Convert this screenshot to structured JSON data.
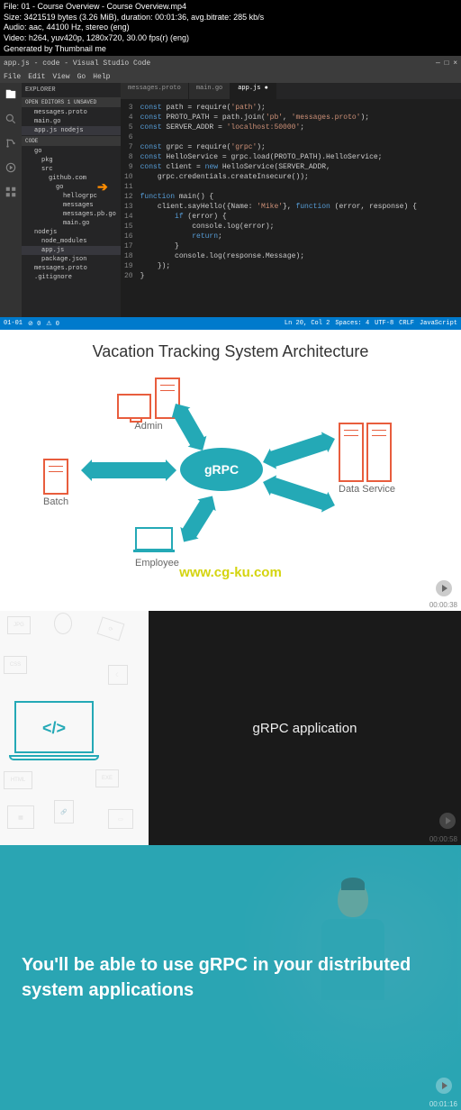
{
  "meta": {
    "l1": "File: 01 - Course Overview - Course Overview.mp4",
    "l2": "Size: 3421519 bytes (3.26 MiB), duration: 00:01:36, avg.bitrate: 285 kb/s",
    "l3": "Audio: aac, 44100 Hz, stereo (eng)",
    "l4": "Video: h264, yuv420p, 1280x720, 30.00 fps(r) (eng)",
    "l5": "Generated by Thumbnail me"
  },
  "vscode": {
    "title": "app.js - code - Visual Studio Code",
    "menu": [
      "File",
      "Edit",
      "View",
      "Go",
      "Help"
    ],
    "explorer": "EXPLORER",
    "openEditors": "OPEN EDITORS 1 UNSAVED",
    "files": [
      "messages.proto",
      "main.go",
      "app.js   nodejs"
    ],
    "codeSection": "CODE",
    "tree": [
      "go",
      "pkg",
      "src",
      "github.com",
      "go",
      "hellogrpc",
      "messages",
      "messages.pb.go",
      "main.go",
      "nodejs",
      "node_modules",
      "app.js",
      "package.json",
      "messages.proto",
      ".gitignore"
    ],
    "tabs": [
      "messages.proto",
      "main.go",
      "app.js"
    ],
    "statusbar": {
      "left": [
        "01-01",
        "0",
        "0",
        "0"
      ],
      "right": [
        "Ln 20, Col 2",
        "Spaces: 4",
        "UTF-8",
        "CRLF",
        "JavaScript"
      ]
    }
  },
  "code": {
    "lines": [
      "const path = require('path');",
      "const PROTO_PATH = path.join('pb', 'messages.proto');",
      "const SERVER_ADDR = 'localhost:50000';",
      "",
      "const grpc = require('grpc');",
      "const HelloService = grpc.load(PROTO_PATH).HelloService;",
      "const client = new HelloService(SERVER_ADDR,",
      "    grpc.credentials.createInsecure());",
      "",
      "function main() {",
      "    client.sayHello({Name: 'Mike'}, function (error, response) {",
      "        if (error) {",
      "            console.log(error);",
      "            return;",
      "        }",
      "        console.log(response.Message);",
      "    });",
      "}"
    ],
    "start": 3
  },
  "panel2": {
    "title": "Vacation Tracking System Architecture",
    "admin": "Admin",
    "batch": "Batch",
    "employee": "Employee",
    "dataservice": "Data Service",
    "grpc": "gRPC",
    "watermark": "www.cg-ku.com",
    "ts": "00:00:38"
  },
  "panel3": {
    "text": "gRPC application",
    "ts": "00:00:58"
  },
  "panel4": {
    "text": "You'll be able to use gRPC in your distributed system applications",
    "ts": "00:01:16"
  }
}
